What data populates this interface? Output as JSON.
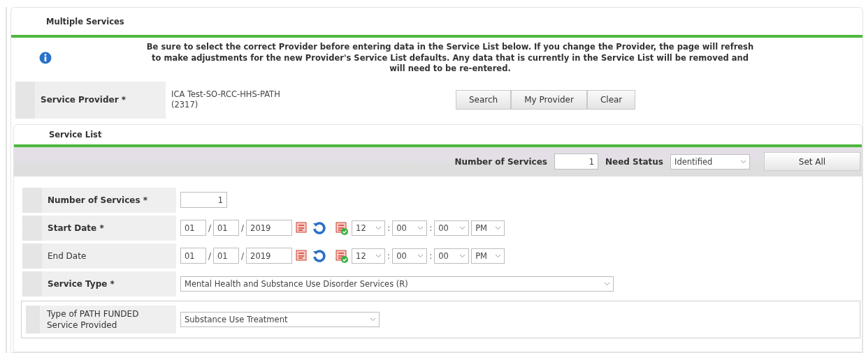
{
  "header": {
    "title": "Multiple Services"
  },
  "notice": {
    "lines": [
      "Be sure to select the correct Provider before entering data in the Service List below. If you change the Provider, the page will refresh",
      "to make adjustments for the new Provider's Service List defaults. Any data that is currently in the Service List will be removed and",
      "will need to be re-entered."
    ]
  },
  "provider": {
    "label": "Service Provider *",
    "value_lines": [
      "ICA Test-SO-RCC-HHS-PATH",
      "(2317)"
    ],
    "buttons": [
      "Search",
      "My Provider",
      "Clear"
    ]
  },
  "service_list": {
    "title": "Service List",
    "toolbar": {
      "count_label": "Number of Services",
      "count_value": "1",
      "status_label": "Need Status",
      "status_value": "Identified",
      "button": "Set All"
    },
    "rows": [
      {
        "kind": "number",
        "label": "Number of Services *",
        "bold": true,
        "value": "1"
      },
      {
        "kind": "datetime",
        "label": "Start Date *",
        "bold": true,
        "month": "01",
        "day": "01",
        "year": "2019",
        "date_sep": [
          "/",
          "/"
        ],
        "hour": "12",
        "minute": "00",
        "second": "00",
        "time_sep": [
          ":",
          ":"
        ],
        "ampm": "PM"
      },
      {
        "kind": "datetime",
        "label": "End Date",
        "bold": false,
        "month": "01",
        "day": "01",
        "year": "2019",
        "date_sep": [
          "/",
          "/"
        ],
        "hour": "12",
        "minute": "00",
        "second": "00",
        "time_sep": [
          ":",
          ":"
        ],
        "ampm": "PM"
      },
      {
        "kind": "select",
        "label": "Service Type *",
        "bold": true,
        "value": "Mental Health and Substance Use Disorder Services (R)"
      }
    ],
    "path": {
      "label_lines": [
        "Type of PATH FUNDED",
        "Service Provided"
      ],
      "value": "Substance Use Treatment"
    }
  }
}
